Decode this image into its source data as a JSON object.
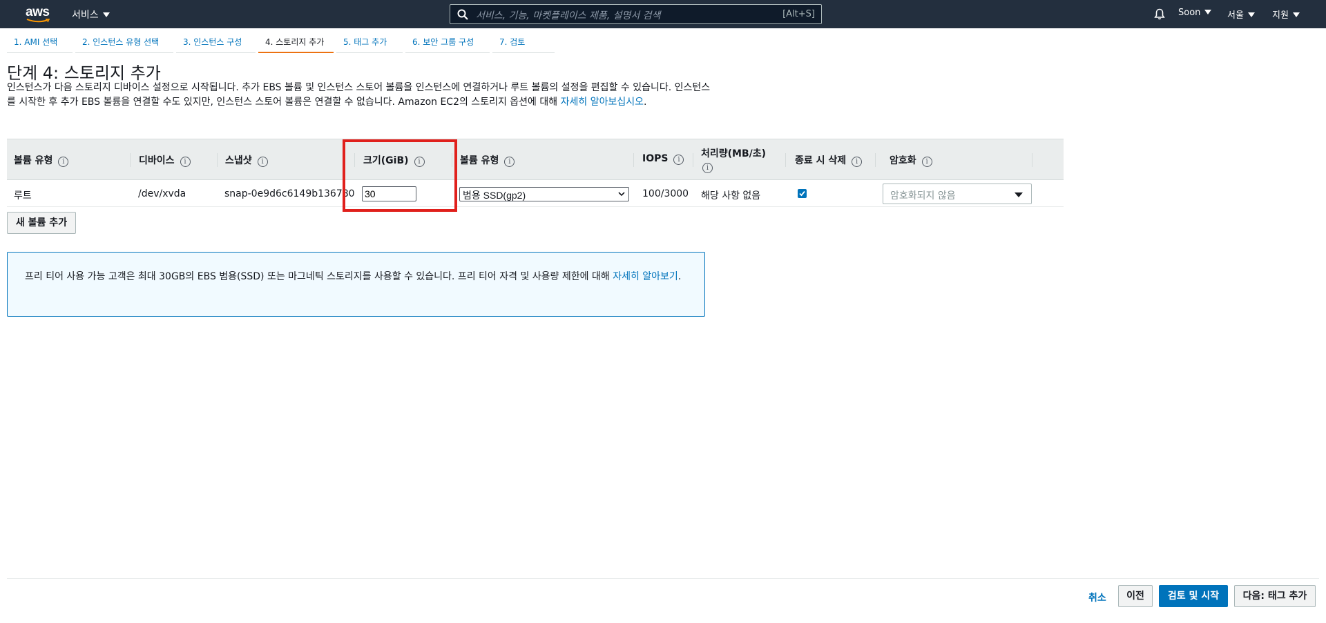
{
  "nav": {
    "logo_text": "aws",
    "services_label": "서비스",
    "search_placeholder": "서비스, 기능, 마켓플레이스 제품, 설명서 검색",
    "search_shortcut": "[Alt+S]",
    "user_label": "Soon",
    "region_label": "서울",
    "support_label": "지원"
  },
  "steps": [
    {
      "label": "1. AMI 선택"
    },
    {
      "label": "2. 인스턴스 유형 선택"
    },
    {
      "label": "3. 인스턴스 구성"
    },
    {
      "label": "4. 스토리지 추가"
    },
    {
      "label": "5. 태그 추가"
    },
    {
      "label": "6. 보안 그룹 구성"
    },
    {
      "label": "7. 검토"
    }
  ],
  "page": {
    "title": "단계 4: 스토리지 추가",
    "description": "인스턴스가 다음 스토리지 디바이스 설정으로 시작됩니다. 추가 EBS 볼륨 및 인스턴스 스토어 볼륨을 인스턴스에 연결하거나 루트 볼륨의 설정을 편집할 수 있습니다. 인스턴스를 시작한 후 추가 EBS 볼륨을 연결할 수도 있지만, 인스턴스 스토어 볼륨은 연결할 수 없습니다. Amazon EC2의 스토리지 옵션에 대해 ",
    "learn_more": "자세히 알아보십시오",
    "description_end": "."
  },
  "table": {
    "headers": {
      "volume_kind": "볼륨 유형",
      "device": "디바이스",
      "snapshot": "스냅샷",
      "size": "크기(GiB)",
      "volume_type": "볼륨 유형",
      "iops": "IOPS",
      "throughput": "처리량(MB/초)",
      "delete_on_termination": "종료 시 삭제",
      "encryption": "암호화"
    },
    "row": {
      "volume_kind": "루트",
      "device": "/dev/xvda",
      "snapshot": "snap-0e9d6c6149b136780",
      "size": "30",
      "volume_type": "범용 SSD(gp2)",
      "iops": "100/3000",
      "throughput": "해당 사항 없음",
      "delete_on_termination": true,
      "encryption": "암호화되지 않음"
    },
    "info_glyph": "i"
  },
  "add_volume_label": "새 볼륨 추가",
  "alert": {
    "text": "프리 티어 사용 가능 고객은 최대 30GB의 EBS 범용(SSD) 또는 마그네틱 스토리지를 사용할 수 있습니다. 프리 티어 자격 및 사용량 제한에 대해 ",
    "link": "자세히 알아보기",
    "text_end": "."
  },
  "footer": {
    "cancel": "취소",
    "previous": "이전",
    "review_launch": "검토 및 시작",
    "next": "다음: 태그 추가"
  },
  "colors": {
    "nav_bg": "#232f3e",
    "link": "#0073bb",
    "active_step": "#ec7211",
    "highlight": "#e0201c"
  }
}
